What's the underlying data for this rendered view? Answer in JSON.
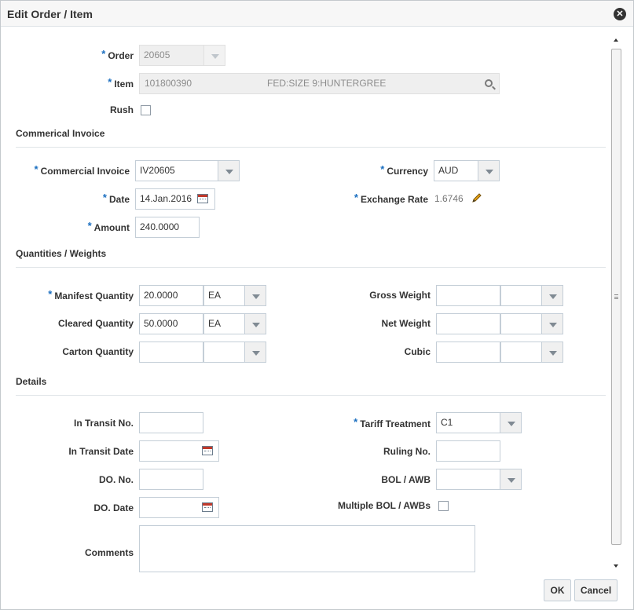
{
  "dialog": {
    "title": "Edit Order / Item",
    "close_icon": "close-icon"
  },
  "order": {
    "label": "Order",
    "value": "20605"
  },
  "item": {
    "label": "Item",
    "value": "101800390",
    "description": "FED:SIZE 9:HUNTERGREE"
  },
  "rush": {
    "label": "Rush",
    "checked": false
  },
  "commercial_invoice_section": {
    "heading": "Commerical Invoice",
    "commercial_invoice": {
      "label": "Commercial Invoice",
      "value": "IV20605"
    },
    "date": {
      "label": "Date",
      "value": "14.Jan.2016"
    },
    "amount": {
      "label": "Amount",
      "value": "240.0000"
    },
    "currency": {
      "label": "Currency",
      "value": "AUD"
    },
    "exchange_rate": {
      "label": "Exchange Rate",
      "value": "1.6746"
    }
  },
  "quantities_section": {
    "heading": "Quantities / Weights",
    "manifest_quantity": {
      "label": "Manifest Quantity",
      "value": "20.0000",
      "uom": "EA"
    },
    "cleared_quantity": {
      "label": "Cleared Quantity",
      "value": "50.0000",
      "uom": "EA"
    },
    "carton_quantity": {
      "label": "Carton Quantity",
      "value": "",
      "uom": ""
    },
    "gross_weight": {
      "label": "Gross Weight",
      "value": "",
      "uom": ""
    },
    "net_weight": {
      "label": "Net Weight",
      "value": "",
      "uom": ""
    },
    "cubic": {
      "label": "Cubic",
      "value": "",
      "uom": ""
    }
  },
  "details_section": {
    "heading": "Details",
    "in_transit_no": {
      "label": "In Transit No.",
      "value": ""
    },
    "in_transit_date": {
      "label": "In Transit Date",
      "value": ""
    },
    "do_no": {
      "label": "DO. No.",
      "value": ""
    },
    "do_date": {
      "label": "DO. Date",
      "value": ""
    },
    "comments": {
      "label": "Comments",
      "value": ""
    },
    "tariff_treatment": {
      "label": "Tariff Treatment",
      "value": "C1"
    },
    "ruling_no": {
      "label": "Ruling No.",
      "value": ""
    },
    "bol_awb": {
      "label": "BOL / AWB",
      "value": ""
    },
    "multiple_bol": {
      "label": "Multiple BOL / AWBs",
      "checked": false
    }
  },
  "footer": {
    "ok_label": "OK",
    "cancel_label": "Cancel"
  },
  "required_marker": "*",
  "colors": {
    "required": "#1b6fc0",
    "border": "#c4ced7",
    "readonly_bg": "#efefef"
  }
}
